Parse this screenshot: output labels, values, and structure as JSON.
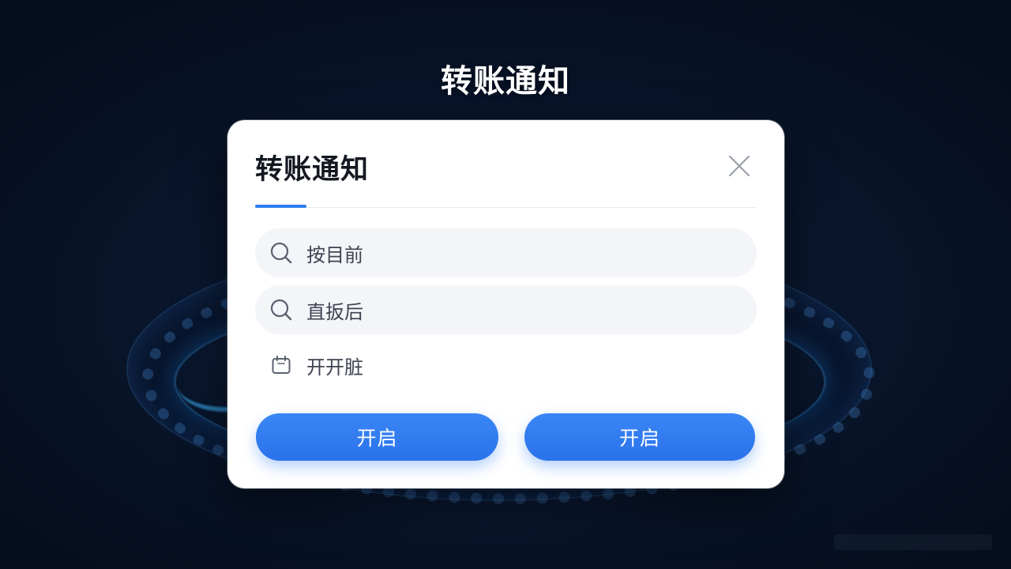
{
  "page": {
    "title": "转账通知"
  },
  "dialog": {
    "title": "转账通知",
    "accent_color": "#2f7cf0",
    "close_icon": "close-icon",
    "fields": [
      {
        "icon": "search-icon",
        "text": "按目前"
      },
      {
        "icon": "search-icon",
        "text": "直扳后"
      }
    ],
    "date_field": {
      "icon": "calendar-icon",
      "text": "开开脏"
    },
    "buttons": {
      "left_label": "开启",
      "right_label": "开启"
    }
  }
}
